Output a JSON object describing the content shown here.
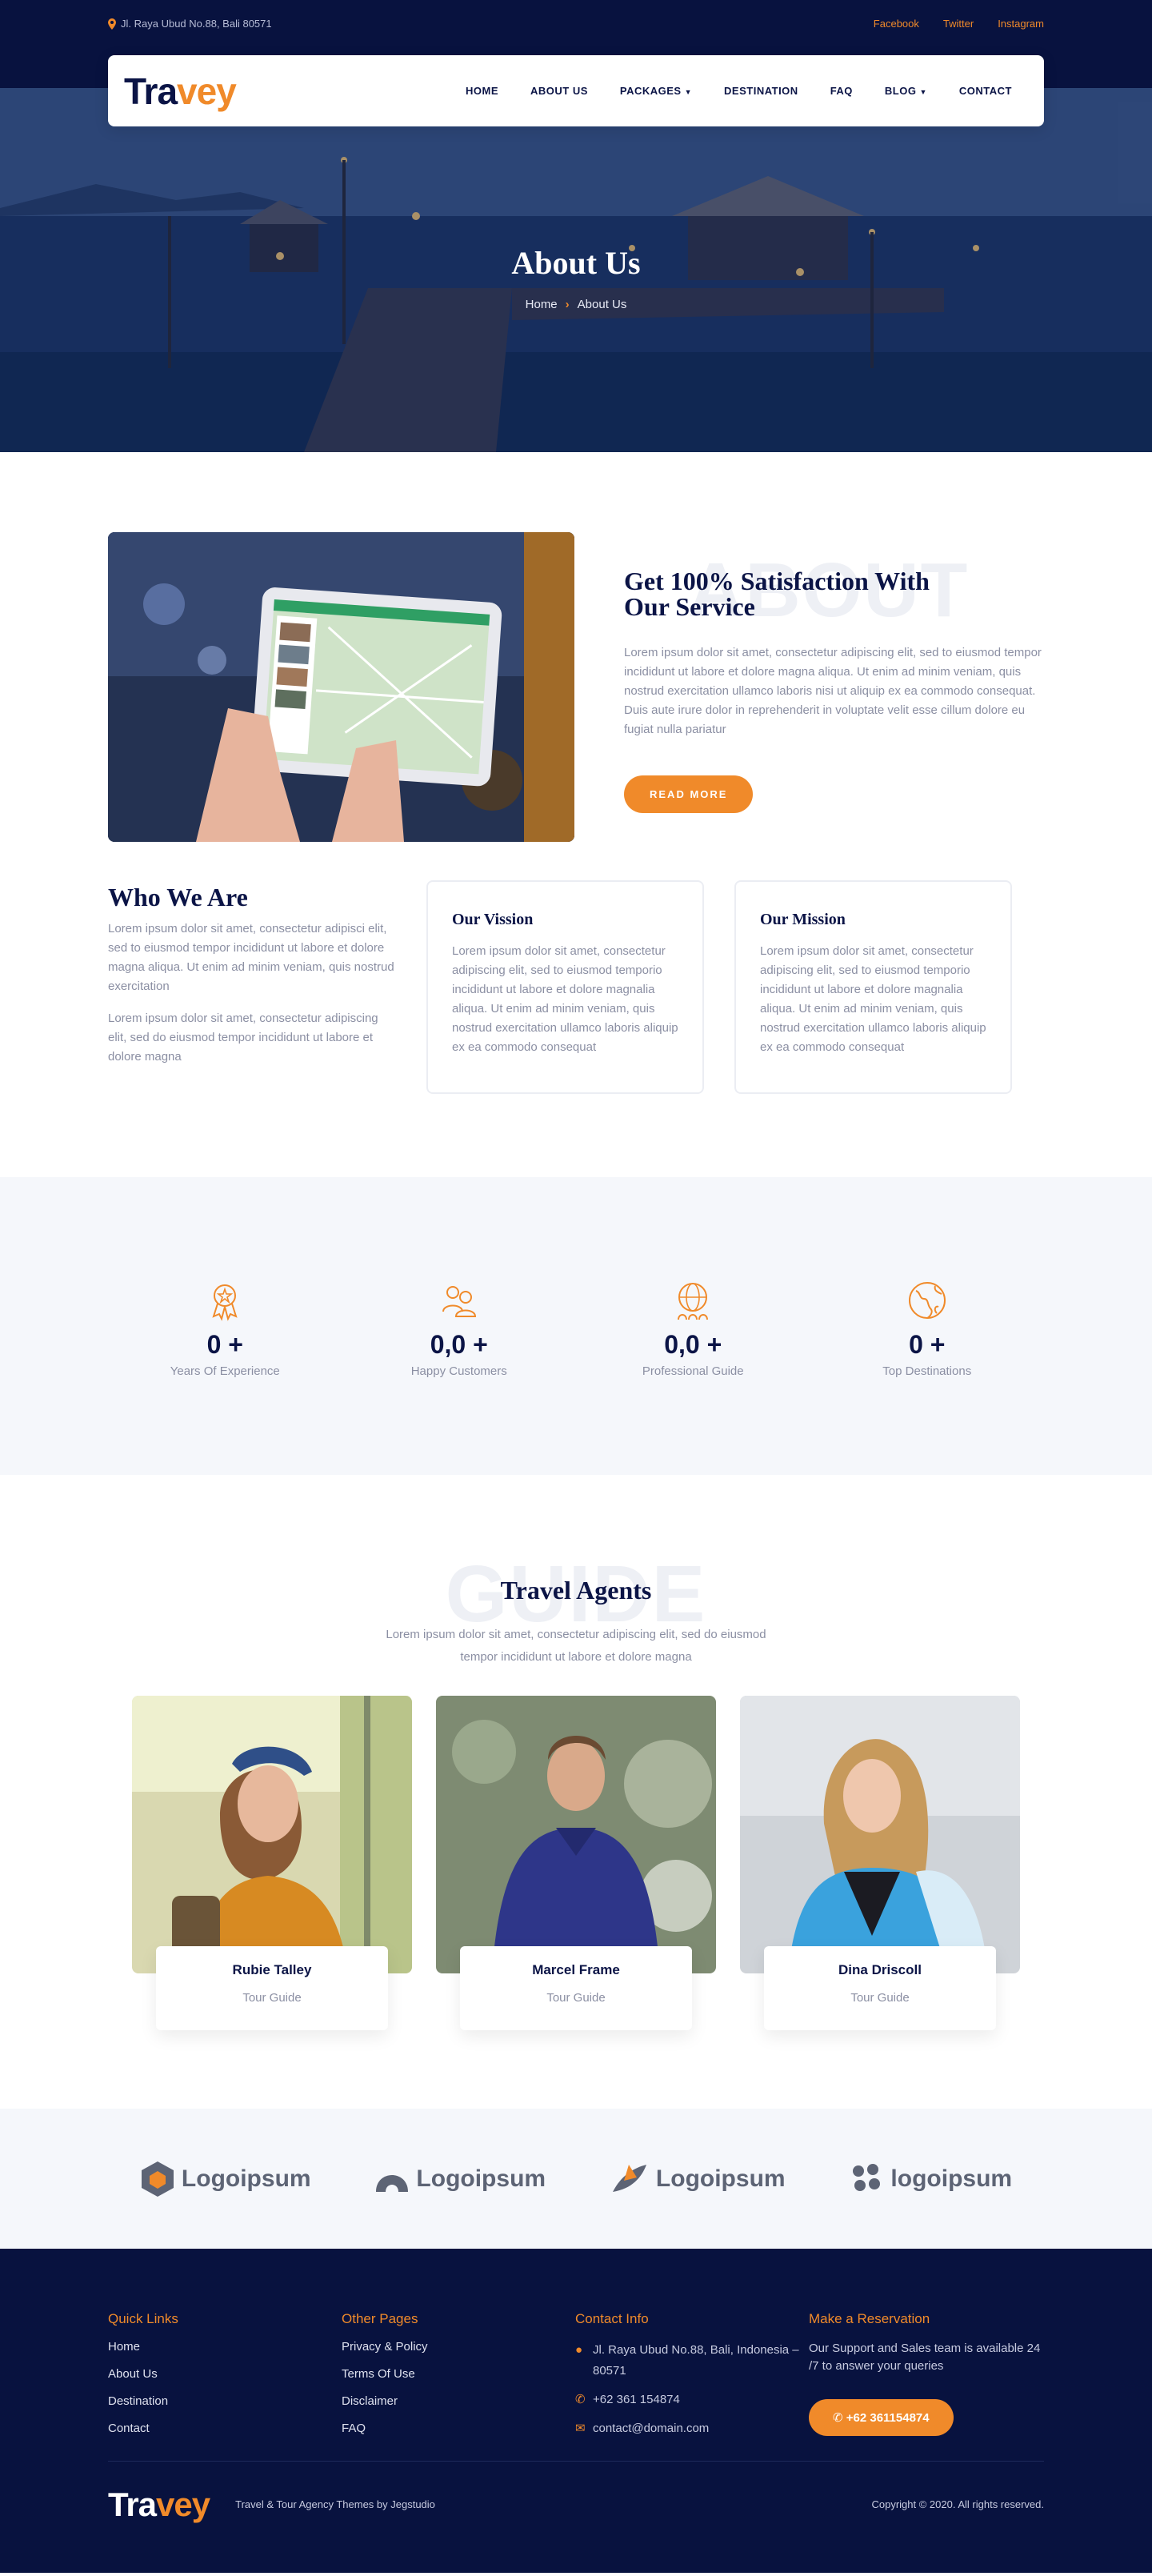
{
  "topbar": {
    "address": "Jl. Raya Ubud No.88, Bali 80571",
    "social": [
      "Facebook",
      "Twitter",
      "Instagram"
    ]
  },
  "brand": {
    "logo_main": "Tra",
    "logo_accent": "vey"
  },
  "nav": {
    "items": [
      {
        "label": "HOME",
        "active": false,
        "dropdown": false
      },
      {
        "label": "ABOUT US",
        "active": true,
        "dropdown": false
      },
      {
        "label": "PACKAGES",
        "active": false,
        "dropdown": true
      },
      {
        "label": "DESTINATION",
        "active": false,
        "dropdown": false
      },
      {
        "label": "FAQ",
        "active": false,
        "dropdown": false
      },
      {
        "label": "BLOG",
        "active": false,
        "dropdown": true
      },
      {
        "label": "CONTACT",
        "active": false,
        "dropdown": false
      }
    ]
  },
  "hero": {
    "title": "About Us",
    "breadcrumb_home": "Home",
    "breadcrumb_current": "About Us"
  },
  "satisfaction": {
    "watermark": "ABOUT",
    "title_line1": "Get 100% Satisfaction With",
    "title_line2": "Our Service",
    "body": "Lorem ipsum dolor sit amet, consectetur adipiscing elit, sed to eiusmod tempor incididunt ut labore et dolore magna aliqua. Ut enim ad minim veniam, quis nostrud exercitation ullamco laboris nisi ut aliquip ex ea commodo consequat. Duis aute irure dolor in reprehenderit in voluptate velit esse cillum dolore eu fugiat nulla pariatur",
    "button": "READ MORE"
  },
  "who": {
    "title": "Who We Are",
    "p1": "Lorem ipsum dolor sit amet, consectetur adipisci elit, sed to eiusmod tempor incididunt ut labore et dolore magna aliqua. Ut enim ad minim veniam, quis nostrud exercitation",
    "p2": "Lorem ipsum dolor sit amet, consectetur adipiscing elit, sed do eiusmod tempor incididunt ut labore et dolore magna",
    "vision_title": "Our Vission",
    "vision_body": "Lorem ipsum dolor sit amet, consectetur adipiscing elit, sed to eiusmod temporio incididunt ut labore et dolore magnalia aliqua. Ut enim ad minim veniam, quis nostrud exercitation ullamco laboris aliquip ex ea commodo consequat",
    "mission_title": "Our Mission",
    "mission_body": "Lorem ipsum dolor sit amet, consectetur adipiscing elit, sed to eiusmod temporio incididunt ut labore et dolore magnalia aliqua. Ut enim ad minim veniam, quis nostrud exercitation ullamco laboris aliquip ex ea commodo consequat"
  },
  "stats": [
    {
      "icon": "award-icon",
      "value": "0 +",
      "label": "Years Of Experience"
    },
    {
      "icon": "customers-icon",
      "value": "0,0 +",
      "label": "Happy Customers"
    },
    {
      "icon": "globe-people-icon",
      "value": "0,0 +",
      "label": "Professional Guide"
    },
    {
      "icon": "earth-icon",
      "value": "0 +",
      "label": "Top Destinations"
    }
  ],
  "agents": {
    "watermark": "GUIDE",
    "title": "Travel Agents",
    "subtitle": "Lorem ipsum dolor sit amet, consectetur adipiscing elit, sed do eiusmod tempor incididunt ut labore et dolore magna",
    "list": [
      {
        "name": "Rubie Talley",
        "role": "Tour Guide"
      },
      {
        "name": "Marcel Frame",
        "role": "Tour Guide"
      },
      {
        "name": "Dina Driscoll",
        "role": "Tour Guide"
      }
    ]
  },
  "partners": [
    "Logoipsum",
    "Logoipsum",
    "Logoipsum",
    "logoipsum"
  ],
  "footer": {
    "quick_title": "Quick Links",
    "quick_links": [
      "Home",
      "About Us",
      "Destination",
      "Contact"
    ],
    "other_title": "Other Pages",
    "other_links": [
      "Privacy & Policy",
      "Terms Of Use",
      "Disclaimer",
      "FAQ"
    ],
    "contact_title": "Contact Info",
    "contact_address": "Jl. Raya Ubud No.88, Bali, Indonesia – 80571",
    "contact_phone": "+62 361 154874",
    "contact_email": "contact@domain.com",
    "reserve_title": "Make a Reservation",
    "reserve_desc": "Our Support and Sales team is available 24 /7 to answer your queries",
    "reserve_button": "+62 361154874",
    "tagline": "Travel & Tour Agency Themes by Jegstudio",
    "copyright": "Copyright © 2020. All rights reserved."
  },
  "colors": {
    "navy": "#08123f",
    "accent": "#f08a2a",
    "text": "#0b1446",
    "muted": "#8b8fa3"
  }
}
